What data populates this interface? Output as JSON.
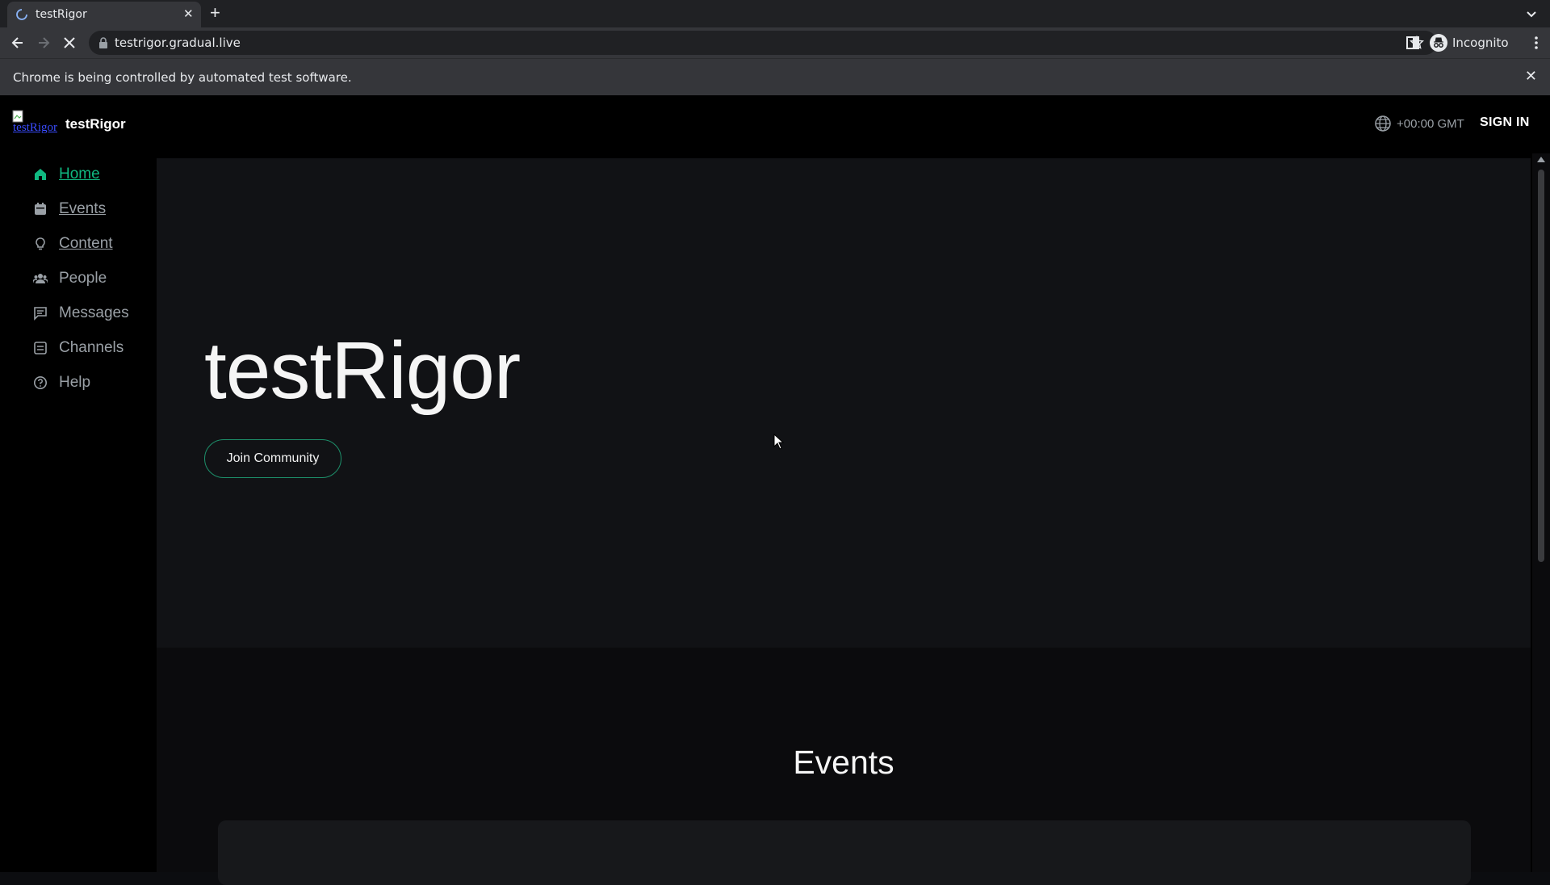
{
  "browser": {
    "tab_title": "testRigor",
    "url": "testrigor.gradual.live",
    "profile_label": "Incognito",
    "infobar_text": "Chrome is being controlled by automated test software."
  },
  "header": {
    "logo_alt": "testRigor",
    "brand": "testRigor",
    "timezone": "+00:00 GMT",
    "sign_in": "SIGN IN"
  },
  "sidebar": {
    "items": [
      {
        "label": "Home",
        "icon": "home-icon"
      },
      {
        "label": "Events",
        "icon": "calendar-icon"
      },
      {
        "label": "Content",
        "icon": "lightbulb-icon"
      },
      {
        "label": "People",
        "icon": "people-icon"
      },
      {
        "label": "Messages",
        "icon": "message-icon"
      },
      {
        "label": "Channels",
        "icon": "channels-icon"
      },
      {
        "label": "Help",
        "icon": "help-icon"
      }
    ]
  },
  "hero": {
    "title": "testRigor",
    "cta": "Join Community"
  },
  "events": {
    "title": "Events"
  },
  "colors": {
    "accent": "#10b981",
    "background": "#000000",
    "hero_bg": "#111215"
  }
}
